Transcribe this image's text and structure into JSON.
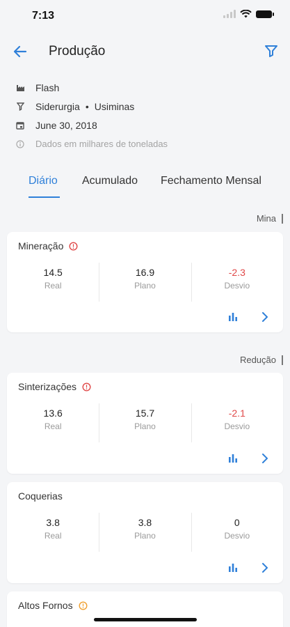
{
  "status": {
    "time": "7:13"
  },
  "nav": {
    "title": "Produção"
  },
  "info": {
    "report": "Flash",
    "sector": "Siderurgia",
    "company": "Usiminas",
    "date": "June 30, 2018",
    "note": "Dados em milhares de toneladas"
  },
  "tabs": [
    "Diário",
    "Acumulado",
    "Fechamento Mensal"
  ],
  "sections": {
    "mina": "Mina",
    "reducao": "Redução"
  },
  "cards": [
    {
      "title": "Mineração",
      "alert_color": "#e04848",
      "real": "14.5",
      "plano": "16.9",
      "desvio": "-2.3",
      "real_label": "Real",
      "plano_label": "Plano",
      "desvio_label": "Desvio"
    },
    {
      "title": "Sinterizações",
      "alert_color": "#e04848",
      "real": "13.6",
      "plano": "15.7",
      "desvio": "-2.1",
      "real_label": "Real",
      "plano_label": "Plano",
      "desvio_label": "Desvio"
    },
    {
      "title": "Coquerias",
      "real": "3.8",
      "plano": "3.8",
      "desvio": "0",
      "real_label": "Real",
      "plano_label": "Plano",
      "desvio_label": "Desvio"
    },
    {
      "title": "Altos Fornos",
      "alert_color": "#f0a030"
    }
  ],
  "colors": {
    "accent": "#2f80d9",
    "negative": "#e04848",
    "warning": "#f0a030"
  },
  "icons": [
    "back-arrow-icon",
    "filter-icon",
    "factory-icon",
    "funnel-icon",
    "calendar-icon",
    "info-icon",
    "alert-icon",
    "bar-chart-icon",
    "chevron-right-icon"
  ]
}
